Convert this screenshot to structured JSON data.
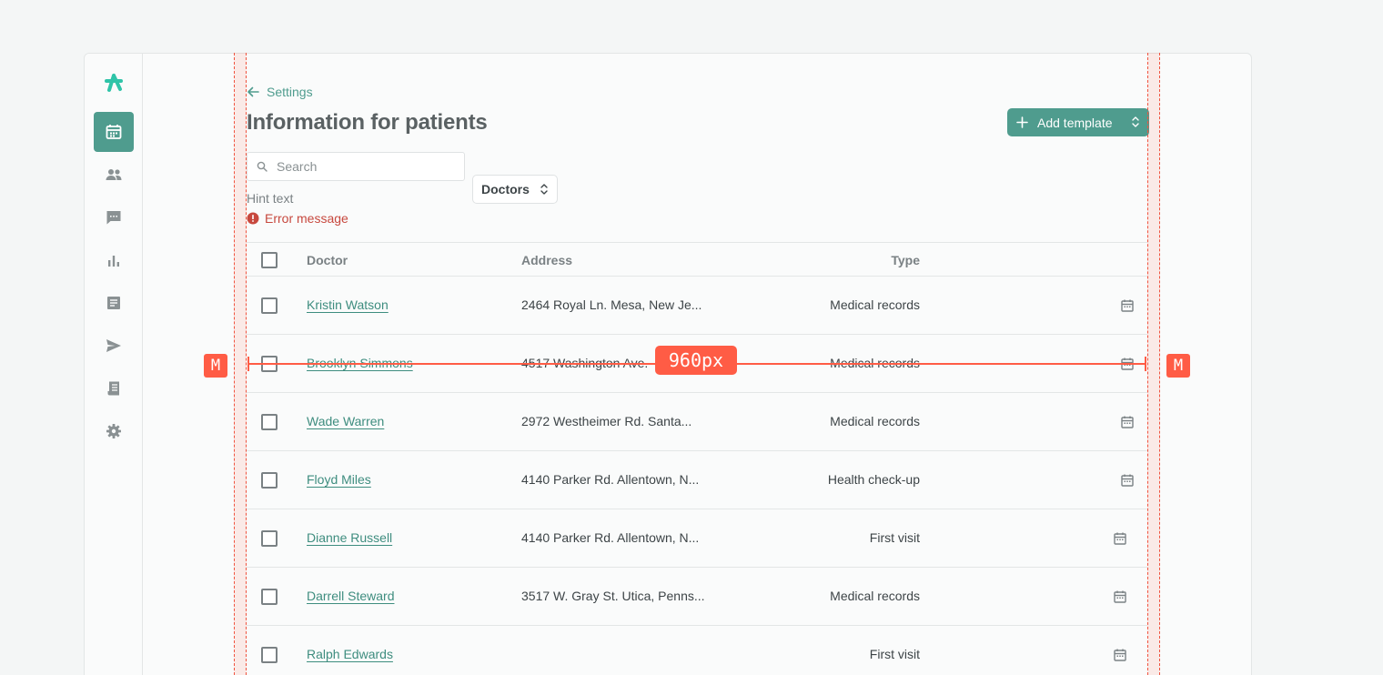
{
  "nav": {
    "items": [
      {
        "name": "calendar-icon",
        "active": true
      },
      {
        "name": "people-icon",
        "active": false
      },
      {
        "name": "chat-icon",
        "active": false
      },
      {
        "name": "bar-chart-icon",
        "active": false
      },
      {
        "name": "document-icon",
        "active": false
      },
      {
        "name": "send-icon",
        "active": false
      },
      {
        "name": "receipt-icon",
        "active": false
      },
      {
        "name": "gear-icon",
        "active": false
      }
    ]
  },
  "header": {
    "back_label": "Settings",
    "title": "Information for patients",
    "add_button_label": "Add template"
  },
  "filters": {
    "search_placeholder": "Search",
    "hint": "Hint text",
    "error": "Error message",
    "dropdown_value": "Doctors"
  },
  "table": {
    "columns": {
      "doctor": "Doctor",
      "address": "Address",
      "type": "Type"
    },
    "rows": [
      {
        "doctor": "Kristin Watson",
        "address": "2464 Royal Ln. Mesa, New Je...",
        "type": "Medical records"
      },
      {
        "doctor": "Brooklyn Simmons",
        "address": "4517 Washington Ave.",
        "type": "Medical records"
      },
      {
        "doctor": "Wade Warren",
        "address": "2972 Westheimer Rd. Santa...",
        "type": "Medical records"
      },
      {
        "doctor": "Floyd Miles",
        "address": "4140 Parker Rd. Allentown, N...",
        "type": "Health check-up"
      },
      {
        "doctor": "Dianne Russell",
        "address": "4140 Parker Rd. Allentown, N...",
        "type": "First visit"
      },
      {
        "doctor": "Darrell Steward",
        "address": "3517 W. Gray St. Utica, Penns...",
        "type": "Medical records"
      },
      {
        "doctor": "Ralph Edwards",
        "address": "",
        "type": "First visit"
      }
    ]
  },
  "overlay": {
    "measure_label": "960px",
    "margin_badge": "M"
  },
  "colors": {
    "accent": "#4f9c8e",
    "error": "#c7483e",
    "guide": "#ff5c45"
  }
}
